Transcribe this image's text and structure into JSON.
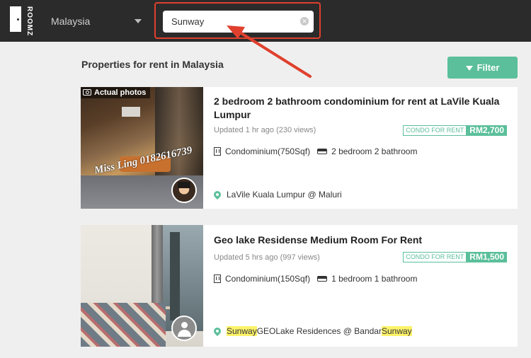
{
  "header": {
    "logo_text": "ROOMZ",
    "country": "Malaysia",
    "search": {
      "value": "Sunway",
      "placeholder": ""
    }
  },
  "main": {
    "heading": "Properties for rent in Malaysia",
    "filter_label": "Filter"
  },
  "listings": [
    {
      "title": "2 bedroom 2 bathroom condominium for rent at LaVile Kuala Lumpur",
      "updated": "Updated 1 hr ago (230 views)",
      "type_tag": "CONDO FOR RENT",
      "price": "RM2,700",
      "property_type": "Condominium(750Sqf)",
      "rooms": "2 bedroom 2 bathroom",
      "location": "LaVile Kuala Lumpur @ Maluri",
      "photo_badge": "Actual photos",
      "photo_watermark": "Miss Ling 0182616739"
    },
    {
      "title": "Geo lake Residense Medium Room For Rent",
      "updated": "Updated 5 hrs ago (997 views)",
      "type_tag": "CONDO FOR RENT",
      "price": "RM1,500",
      "property_type": "Condominium(150Sqf)",
      "rooms": "1 bedroom 1 bathroom",
      "location_parts": [
        "Sunway",
        " GEOLake Residences @ Bandar ",
        "Sunway"
      ]
    }
  ],
  "colors": {
    "accent": "#5bbf9b",
    "annotation": "#e0402d",
    "highlight": "#fdf36a"
  }
}
